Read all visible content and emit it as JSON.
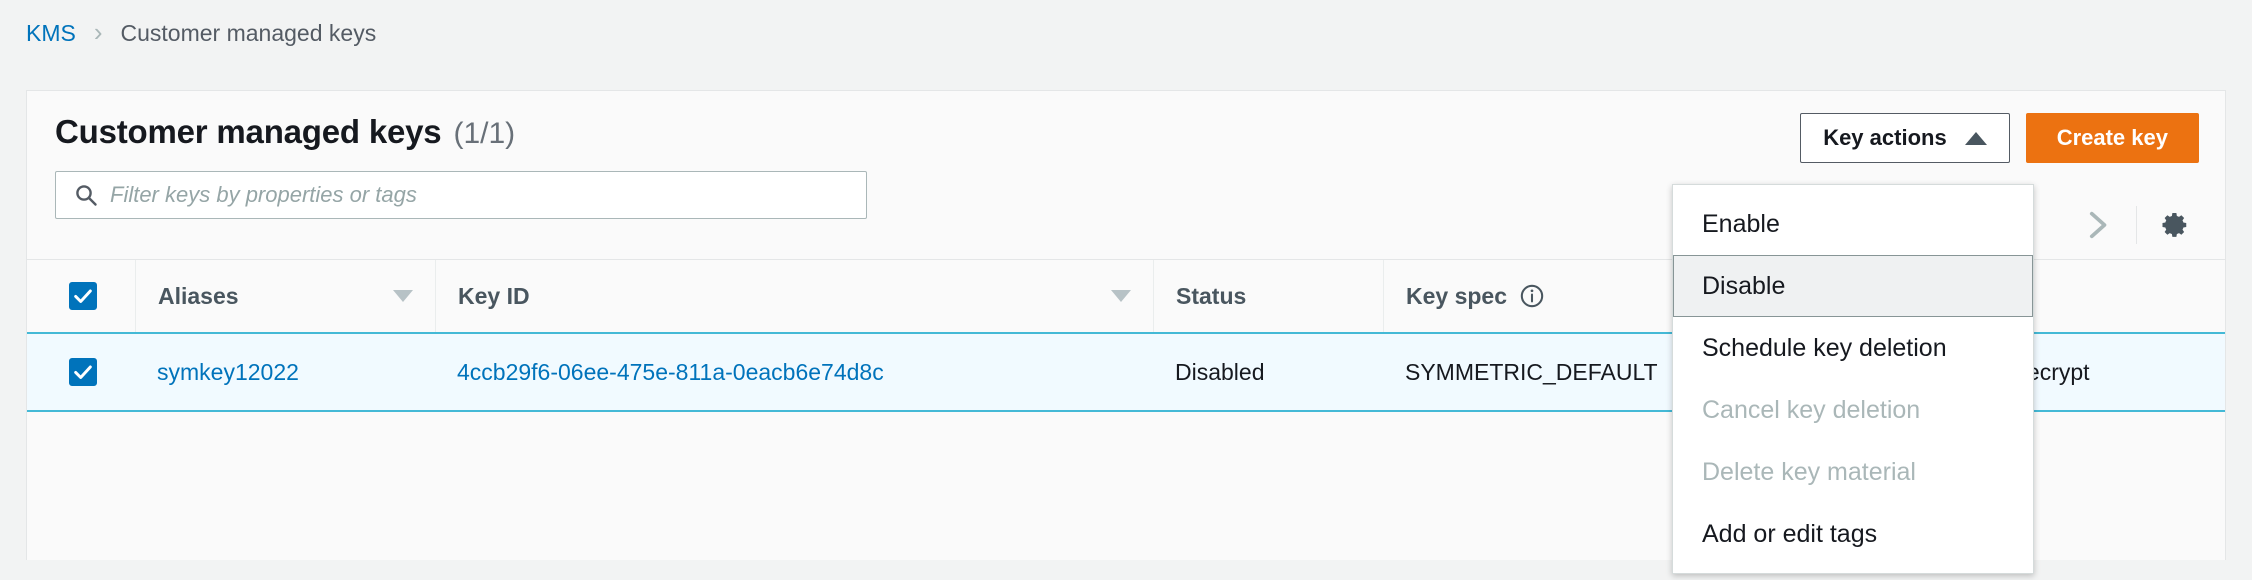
{
  "breadcrumb": {
    "root": "KMS",
    "separator": "›",
    "current": "Customer managed keys"
  },
  "panel": {
    "title": "Customer managed keys",
    "count": "(1/1)"
  },
  "search": {
    "placeholder": "Filter keys by properties or tags",
    "value": "",
    "icon": "search-icon"
  },
  "actions": {
    "dropdown_label": "Key actions",
    "dropdown_caret": "caret-up-icon",
    "create_label": "Create key",
    "create_color": "#ec7211"
  },
  "tools": {
    "next_page": "chevron-right-icon",
    "settings": "gear-icon"
  },
  "menu": {
    "items": [
      {
        "label": "Enable",
        "state": "normal"
      },
      {
        "label": "Disable",
        "state": "highlighted"
      },
      {
        "label": "Schedule key deletion",
        "state": "normal"
      },
      {
        "label": "Cancel key deletion",
        "state": "disabled"
      },
      {
        "label": "Delete key material",
        "state": "disabled"
      },
      {
        "label": "Add or edit tags",
        "state": "normal"
      }
    ]
  },
  "table": {
    "select_all_checked": true,
    "columns": [
      {
        "label": "Aliases",
        "sortable": true
      },
      {
        "label": "Key ID",
        "sortable": true
      },
      {
        "label": "Status",
        "sortable": false
      },
      {
        "label": "Key spec",
        "sortable": false,
        "info": true
      },
      {
        "label": "",
        "sortable": false
      }
    ],
    "rows": [
      {
        "checked": true,
        "alias": "symkey12022",
        "key_id": "4ccb29f6-06ee-475e-811a-0eacb6e74d8c",
        "status": "Disabled",
        "key_spec": "SYMMETRIC_DEFAULT",
        "key_usage": "Encrypt and decrypt"
      }
    ]
  }
}
